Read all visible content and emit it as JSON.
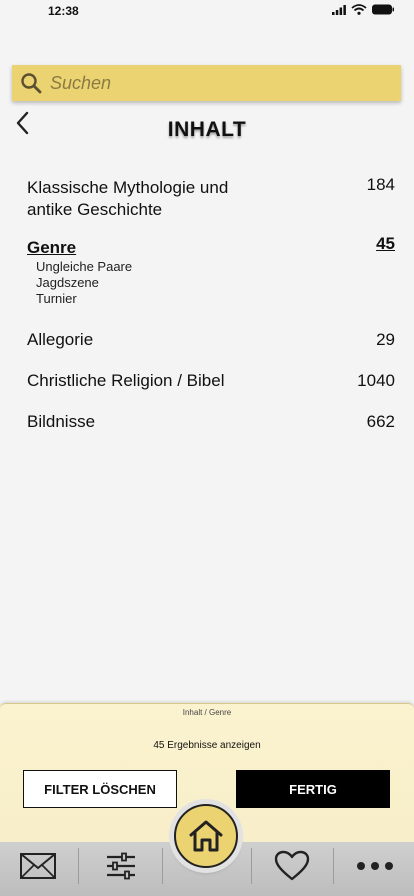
{
  "status_bar": {
    "time": "12:38"
  },
  "search": {
    "placeholder": "Suchen",
    "value": ""
  },
  "header": {
    "title": "INHALT"
  },
  "categories": [
    {
      "label": "Klassische Mythologie und\nantike Geschichte",
      "count": "184",
      "active": false
    },
    {
      "label": "Genre",
      "count": "45",
      "active": true,
      "subitems": [
        "Ungleiche Paare",
        "Jagdszene",
        "Turnier"
      ]
    },
    {
      "label": "Allegorie",
      "count": "29",
      "active": false
    },
    {
      "label": "Christliche Religion / Bibel",
      "count": "1040",
      "active": false
    },
    {
      "label": "Bildnisse",
      "count": "662",
      "active": false
    }
  ],
  "filter_panel": {
    "breadcrumb": "Inhalt / Genre",
    "result_text": "45 Ergebnisse anzeigen",
    "clear_label": "FILTER LÖSCHEN",
    "done_label": "FERTIG"
  },
  "tab_bar": {
    "items": [
      {
        "icon": "mail-icon"
      },
      {
        "icon": "filter-sliders-icon"
      },
      {
        "icon": "home-icon"
      },
      {
        "icon": "heart-icon"
      },
      {
        "icon": "more-dots-icon"
      }
    ]
  },
  "colors": {
    "accent": "#ecd371",
    "panel": "#fbf3cf",
    "tab_bar": "#c8c8c8"
  }
}
